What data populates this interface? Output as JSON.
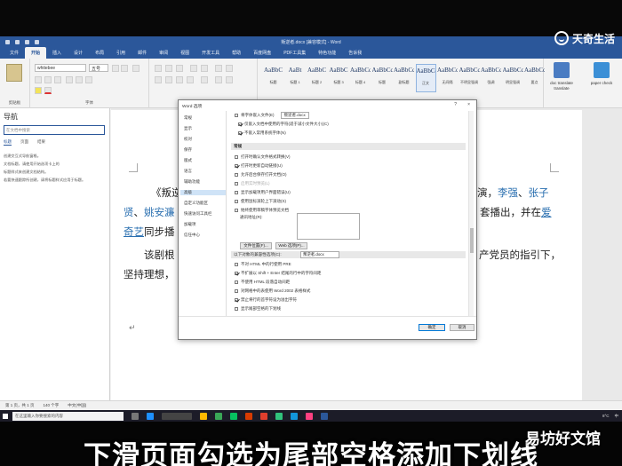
{
  "watermark": {
    "top_right": "天奇生活",
    "bottom_right": "易坊好文馆"
  },
  "subtitle": "下滑页面勾选为尾部空格添加下划线",
  "word": {
    "title": "叛逆者.docx [兼容模式] - Word",
    "tabs": [
      "文件",
      "开始",
      "插入",
      "设计",
      "布局",
      "引用",
      "邮件",
      "审阅",
      "视图",
      "开发工具",
      "帮助",
      "百度网盘",
      "PDF工具集",
      "特色功能",
      "告诉我"
    ],
    "active_tab": "开始",
    "font_name": "whitebee",
    "font_size": "五号",
    "groups": {
      "clipboard": "剪贴板",
      "font": "字体",
      "paragraph": "段落",
      "styles": "样式"
    },
    "styles": [
      {
        "sample": "AaBbC",
        "name": "标题"
      },
      {
        "sample": "AaBt",
        "name": "标题 1"
      },
      {
        "sample": "AaBbC",
        "name": "标题 2"
      },
      {
        "sample": "AaBbC",
        "name": "标题 3"
      },
      {
        "sample": "AaBbCcI",
        "name": "标题 4"
      },
      {
        "sample": "AaBbCcD",
        "name": "标题"
      },
      {
        "sample": "AaBbCcI",
        "name": "副标题"
      },
      {
        "sample": "AaBbCcI",
        "name": "正文"
      },
      {
        "sample": "AaBbCcD",
        "name": "无间隔"
      },
      {
        "sample": "AaBbCcD",
        "name": "不明显强调"
      },
      {
        "sample": "AaBbCcI",
        "name": "强调"
      },
      {
        "sample": "AaBbCcI",
        "name": "明显强调"
      },
      {
        "sample": "AaBbCcI",
        "name": "要点"
      }
    ],
    "tools": [
      {
        "label": "doc translate",
        "sub": "translate"
      },
      {
        "label": "paper check",
        "sub": ""
      }
    ]
  },
  "nav_pane": {
    "title": "导航",
    "search_placeholder": "在文档中搜索",
    "tabs": [
      "标题",
      "页面",
      "结果"
    ],
    "hints": [
      "创建交互式导航窗格。",
      "文档标题，请使用开始选项卡上的",
      "标题样式来创建文档结构。",
      "若要快速跟踪所创建，请将标题样式应用于标题。"
    ]
  },
  "document": {
    "line1_pre": "《叛逆",
    "line1_post": "演，",
    "line1_link1": "李强",
    "line1_sep": "、",
    "line1_link2": "张子",
    "line2_link1": "贤",
    "line2_sep": "、",
    "line2_link2": "姚安濂",
    "line2_post": "套播出，并在",
    "line2_link3": "爱",
    "line3_link1": "奇艺",
    "line3_text": "同步播",
    "para2_start": "该剧根",
    "para2_end": "产党员的指引下，",
    "para3_start": "坚持理想，",
    "return_mark": "↵"
  },
  "statusbar": {
    "page": "第 1 页，共 1 页",
    "words": "140 个字",
    "lang": "中文(中国)"
  },
  "taskbar": {
    "search_placeholder": "在这里输入你要搜索的内容",
    "temperature": "8°C",
    "lang": "中"
  },
  "dialog": {
    "title": "Word 选项",
    "help": "?",
    "close": "×",
    "nav": [
      "常规",
      "显示",
      "校对",
      "保存",
      "版式",
      "语言",
      "辅助功能",
      "高级",
      "自定义功能区",
      "快速访问工具栏",
      "加载项",
      "信任中心"
    ],
    "active_nav": "高级",
    "top_row": "将字体嵌入文件(E)",
    "top_row_select": "叛逆者.docx",
    "options_top": [
      {
        "label": "仅嵌入文档中使用的字符(适于减小文件大小)(C)",
        "checked": true
      },
      {
        "label": "不嵌入常用系统字体(N)",
        "checked": true
      }
    ],
    "section_general": "常规",
    "options_general": [
      {
        "label": "打开时确认文件格式转换(V)",
        "checked": false
      },
      {
        "label": "打开时更新自动链接(U)",
        "checked": true
      },
      {
        "label": "允许后台保存打开文档(O)",
        "checked": false
      },
      {
        "label": "启用实时预览(L)",
        "checked": false,
        "disabled": true
      },
      {
        "label": "显示加载项用户界面错误(U)",
        "checked": false
      },
      {
        "label": "使用鼠标滚轮上下滚动(S)",
        "checked": false
      },
      {
        "label": "始终使用草稿字体预览文档",
        "checked": false
      }
    ],
    "autoformat_label": "通讯地址(R):",
    "file_locations": "文件位置(F)...",
    "web_options": "Web 选项(P)...",
    "compat_label": "以下对象的兼容性选项(C):",
    "compat_select": "叛逆者.docx",
    "compat_options": [
      {
        "label": "不对 HTML 中的行使用 PRE",
        "checked": false
      },
      {
        "label": "不扩展以 Shift + Enter 结尾的行中的字符间距",
        "checked": true
      },
      {
        "label": "不使用 HTML 段落自动间距",
        "checked": false
      },
      {
        "label": "对网格中的表使用 Word 2002 表格样式",
        "checked": false
      },
      {
        "label": "禁止将行的首字符设为溢出字符",
        "checked": true
      },
      {
        "label": "显示尾部空格的下划线",
        "checked": false
      }
    ],
    "ok": "确定",
    "cancel": "取消"
  }
}
